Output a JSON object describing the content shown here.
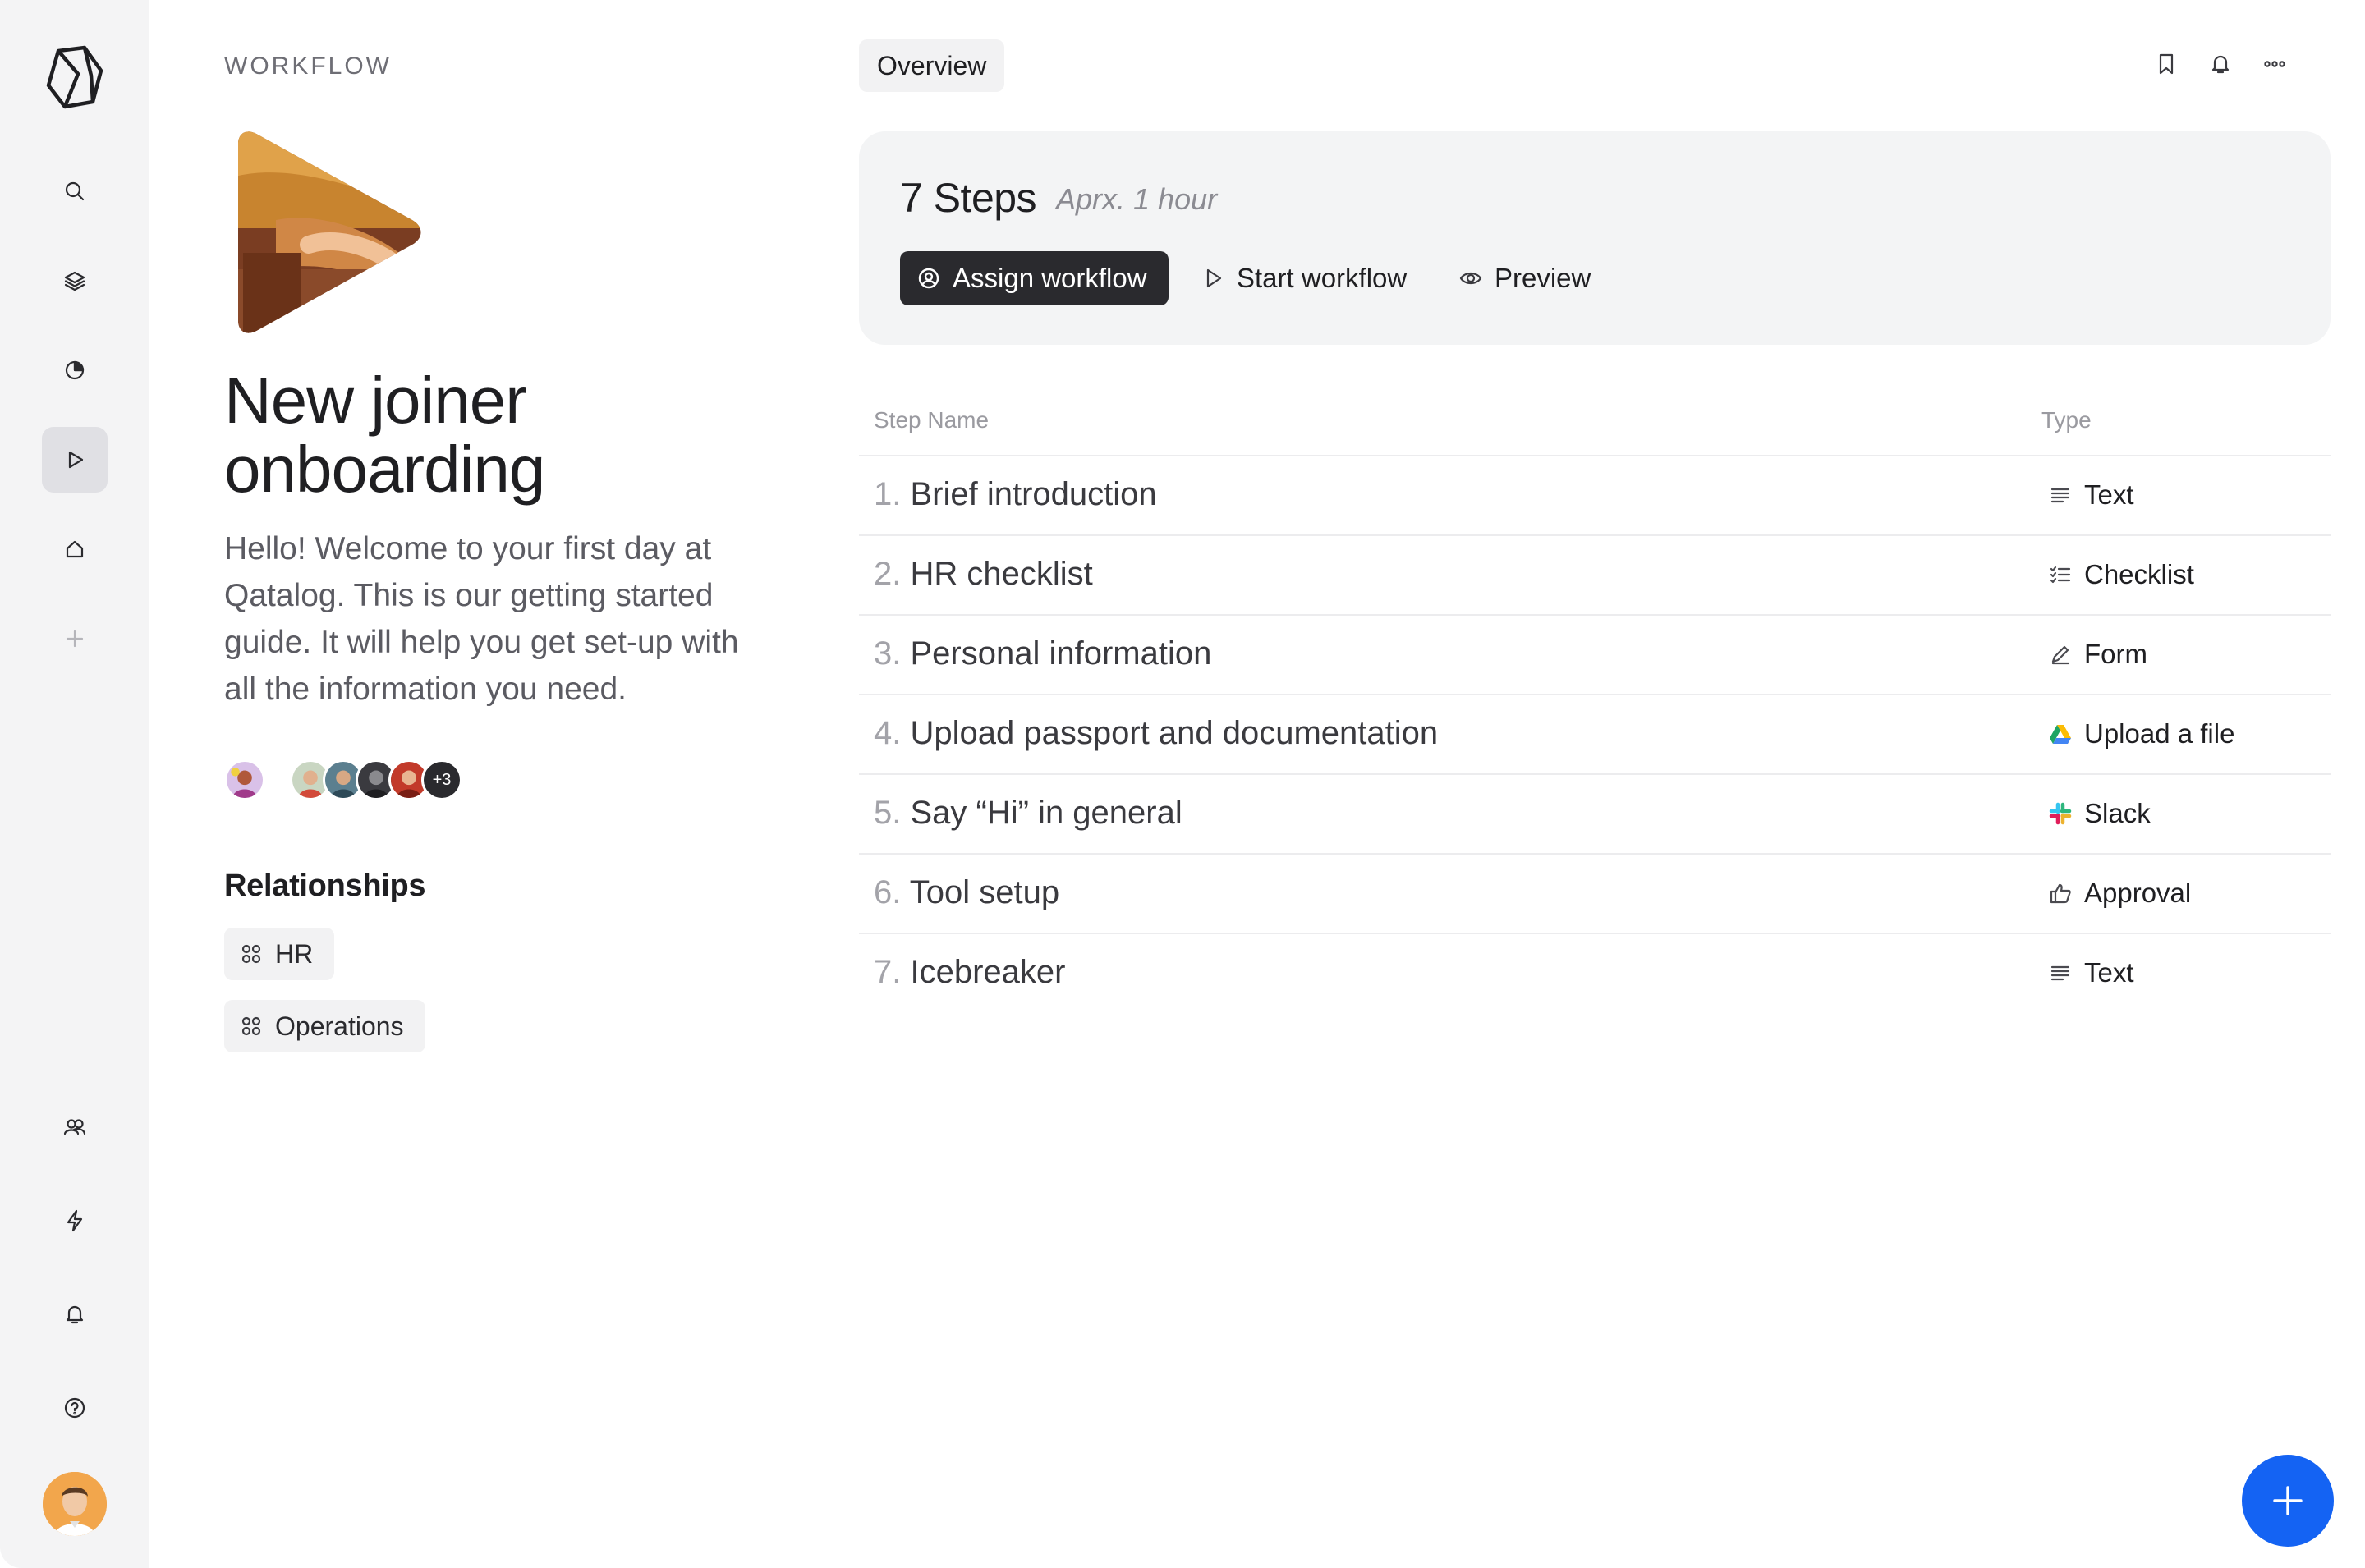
{
  "sidebar": {
    "logo": "qatalog-logo-icon",
    "items": [
      {
        "name": "search",
        "icon": "search-icon"
      },
      {
        "name": "layers",
        "icon": "layers-icon"
      },
      {
        "name": "pie",
        "icon": "pie-chart-icon"
      },
      {
        "name": "workflows",
        "icon": "play-icon",
        "active": true
      },
      {
        "name": "home",
        "icon": "home-icon"
      },
      {
        "name": "add",
        "icon": "plus-icon"
      },
      {
        "name": "people",
        "icon": "people-icon"
      },
      {
        "name": "automation",
        "icon": "lightning-icon"
      },
      {
        "name": "notifications",
        "icon": "bell-icon"
      },
      {
        "name": "help",
        "icon": "help-icon"
      }
    ],
    "user_avatar": "user-avatar"
  },
  "left": {
    "breadcrumb": "WORKFLOW",
    "title_line1": "New joiner",
    "title_line2": "onboarding",
    "description": "Hello! Welcome to your first day at Qatalog. This is our getting started guide. It will help you get set-up with all the information you need.",
    "more_members": "+3",
    "relationships_title": "Relationships",
    "relationships": [
      "HR",
      "Operations"
    ]
  },
  "topbar": {
    "tab": "Overview",
    "icons": [
      "bookmark-icon",
      "bell-icon",
      "more-icon"
    ]
  },
  "card": {
    "steps": "7 Steps",
    "duration": "Aprx. 1 hour",
    "assign_label": "Assign workflow",
    "start_label": "Start workflow",
    "preview_label": "Preview"
  },
  "table": {
    "col_name": "Step Name",
    "col_type": "Type",
    "rows": [
      {
        "num": "1.",
        "name": "Brief introduction",
        "type": "Text",
        "icon": "text-lines-icon"
      },
      {
        "num": "2.",
        "name": "HR checklist",
        "type": "Checklist",
        "icon": "checklist-icon"
      },
      {
        "num": "3.",
        "name": "Personal information",
        "type": "Form",
        "icon": "pencil-icon"
      },
      {
        "num": "4.",
        "name": "Upload passport and documentation",
        "type": "Upload a file",
        "icon": "google-drive-icon"
      },
      {
        "num": "5.",
        "name": "Say “Hi” in general",
        "type": "Slack",
        "icon": "slack-icon"
      },
      {
        "num": "6.",
        "name": "Tool setup",
        "type": "Approval",
        "icon": "thumbs-up-icon"
      },
      {
        "num": "7.",
        "name": "Icebreaker",
        "type": "Text",
        "icon": "text-lines-icon"
      }
    ]
  },
  "fab": {
    "icon": "plus-icon"
  },
  "colors": {
    "accent": "#1463f3",
    "dark_button": "#2a2a2e",
    "sidebar_bg": "#f4f4f5"
  }
}
